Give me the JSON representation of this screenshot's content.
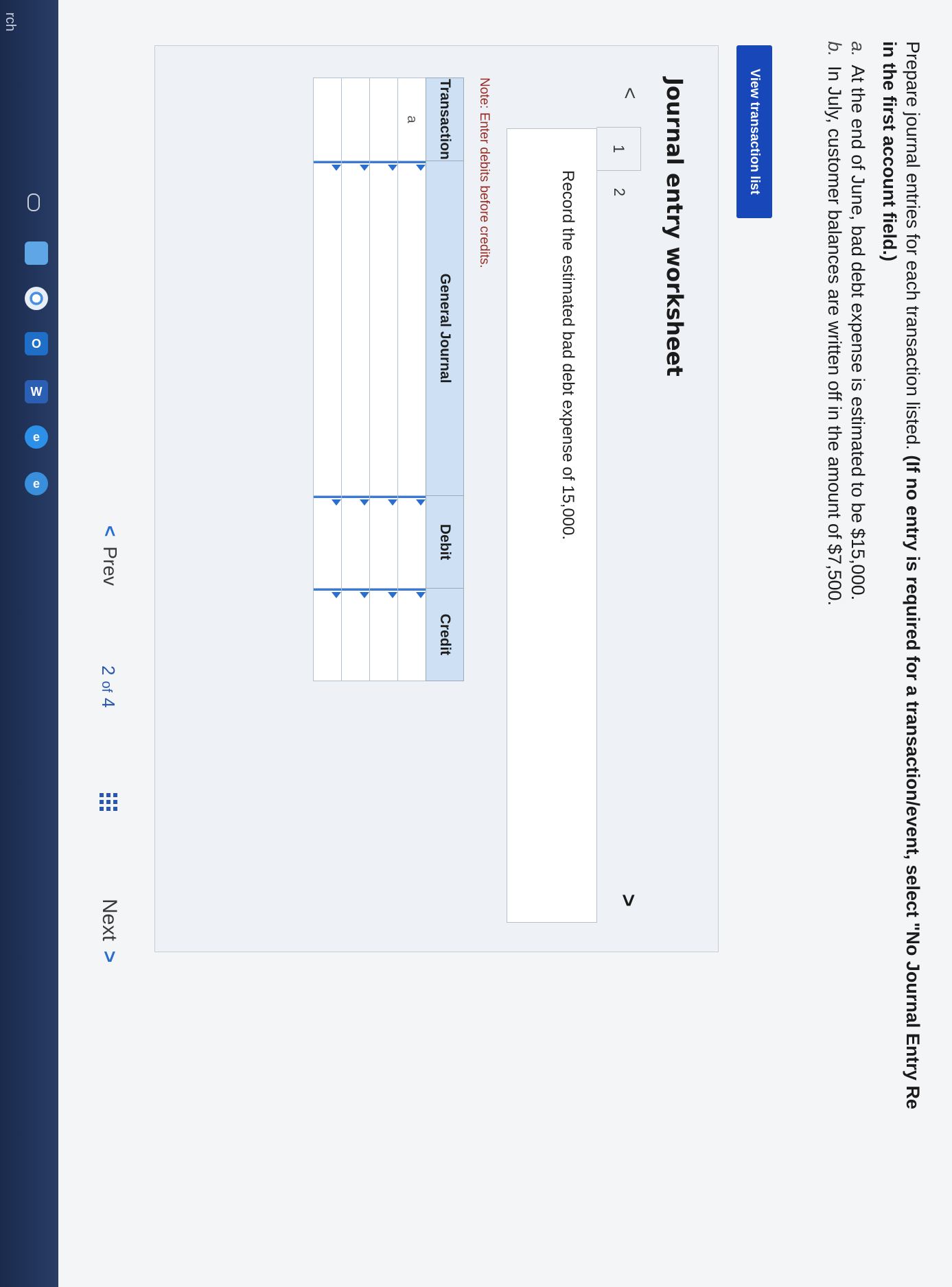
{
  "taskbar": {
    "search_label": "rch"
  },
  "instructions": {
    "lead": "Prepare journal entries for each transaction listed.",
    "bold": "(If no entry is required for a transaction/event, select \"No Journal Entry Re",
    "bold_cont": "in the first account field.)"
  },
  "transactions": [
    {
      "letter": "a.",
      "text": "At the end of June, bad debt expense is estimated to be $15,000."
    },
    {
      "letter": "b.",
      "text": "In July, customer balances are written off in the amount of $7,500."
    }
  ],
  "view_list_label": "View transaction list",
  "worksheet": {
    "title": "Journal entry worksheet",
    "tabs": [
      "1",
      "2"
    ],
    "entry_instruction": "Record the estimated bad debt expense of 15,000.",
    "note": "Note: Enter debits before credits.",
    "table": {
      "headers": [
        "Transaction",
        "General Journal",
        "Debit",
        "Credit"
      ],
      "rows": [
        {
          "transaction": "a"
        },
        {
          "transaction": ""
        },
        {
          "transaction": ""
        },
        {
          "transaction": ""
        }
      ]
    }
  },
  "pager": {
    "prev_label": "Prev",
    "current": "2",
    "of_label": "of",
    "total": "4",
    "next_label": "Next"
  },
  "colors": {
    "accent": "#1747b8",
    "header_fill": "#cde0f4",
    "note_red": "#9a2a22"
  }
}
